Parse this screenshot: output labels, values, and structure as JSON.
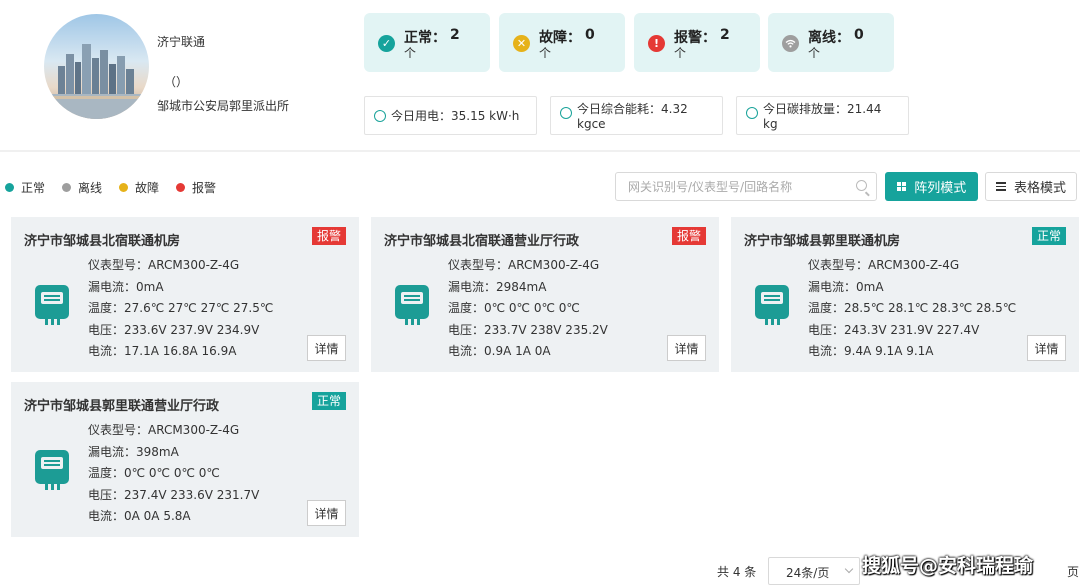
{
  "header": {
    "org_name": "济宁联通",
    "org_paren": "（）",
    "station": "邹城市公安局郭里派出所"
  },
  "stats": [
    {
      "label": "正常：",
      "count": "2",
      "unit": "个",
      "color": "#16a39c",
      "icon": "check-circle-icon"
    },
    {
      "label": "故障：",
      "count": "0",
      "unit": "个",
      "color": "#e6b21a",
      "icon": "fault-circle-icon"
    },
    {
      "label": "报警：",
      "count": "2",
      "unit": "个",
      "color": "#e53935",
      "icon": "alert-circle-icon"
    },
    {
      "label": "离线：",
      "count": "0",
      "unit": "个",
      "color": "#9e9e9e",
      "icon": "wifi-off-icon"
    }
  ],
  "energy": {
    "power": "今日用电：35.15 kW·h",
    "energy_line1": "今日综合能耗：4.32",
    "energy_line2": "kgce",
    "carbon_line1": "今日碳排放量：21.44",
    "carbon_line2": "kg"
  },
  "legend": [
    {
      "label": "正常",
      "color": "#16a39c"
    },
    {
      "label": "离线",
      "color": "#9e9e9e"
    },
    {
      "label": "故障",
      "color": "#e6b21a"
    },
    {
      "label": "报警",
      "color": "#e53935"
    }
  ],
  "toolbar": {
    "search_placeholder": "网关识别号/仪表型号/回路名称",
    "grid_mode": "阵列模式",
    "table_mode": "表格模式"
  },
  "cards": [
    {
      "title": "济宁市邹城县北宿联通机房",
      "status": "报警",
      "status_color": "#e53935",
      "model": "仪表型号：ARCM300-Z-4G",
      "leak": "漏电流：0mA",
      "temp": "温度：27.6℃ 27℃ 27℃ 27.5℃",
      "voltage": "电压：233.6V 237.9V 234.9V",
      "current": "电流：17.1A 16.8A 16.9A",
      "detail": "详情"
    },
    {
      "title": "济宁市邹城县北宿联通营业厅行政",
      "status": "报警",
      "status_color": "#e53935",
      "model": "仪表型号：ARCM300-Z-4G",
      "leak": "漏电流：2984mA",
      "temp": "温度：0℃ 0℃ 0℃ 0℃",
      "voltage": "电压：233.7V 238V 235.2V",
      "current": "电流：0.9A 1A 0A",
      "detail": "详情"
    },
    {
      "title": "济宁市邹城县郭里联通机房",
      "status": "正常",
      "status_color": "#16a39c",
      "model": "仪表型号：ARCM300-Z-4G",
      "leak": "漏电流：0mA",
      "temp": "温度：28.5℃ 28.1℃ 28.3℃ 28.5℃",
      "voltage": "电压：243.3V 231.9V 227.4V",
      "current": "电流：9.4A 9.1A 9.1A",
      "detail": "详情"
    },
    {
      "title": "济宁市邹城县郭里联通营业厅行政",
      "status": "正常",
      "status_color": "#16a39c",
      "model": "仪表型号：ARCM300-Z-4G",
      "leak": "漏电流：398mA",
      "temp": "温度：0℃ 0℃ 0℃ 0℃",
      "voltage": "电压：237.4V 233.6V 231.7V",
      "current": "电流：0A 0A 5.8A",
      "detail": "详情"
    }
  ],
  "pagination": {
    "total": "共 4 条",
    "page_size": "24条/页",
    "page_unit": "页"
  },
  "watermark": "搜狐号@安科瑞程瑜"
}
